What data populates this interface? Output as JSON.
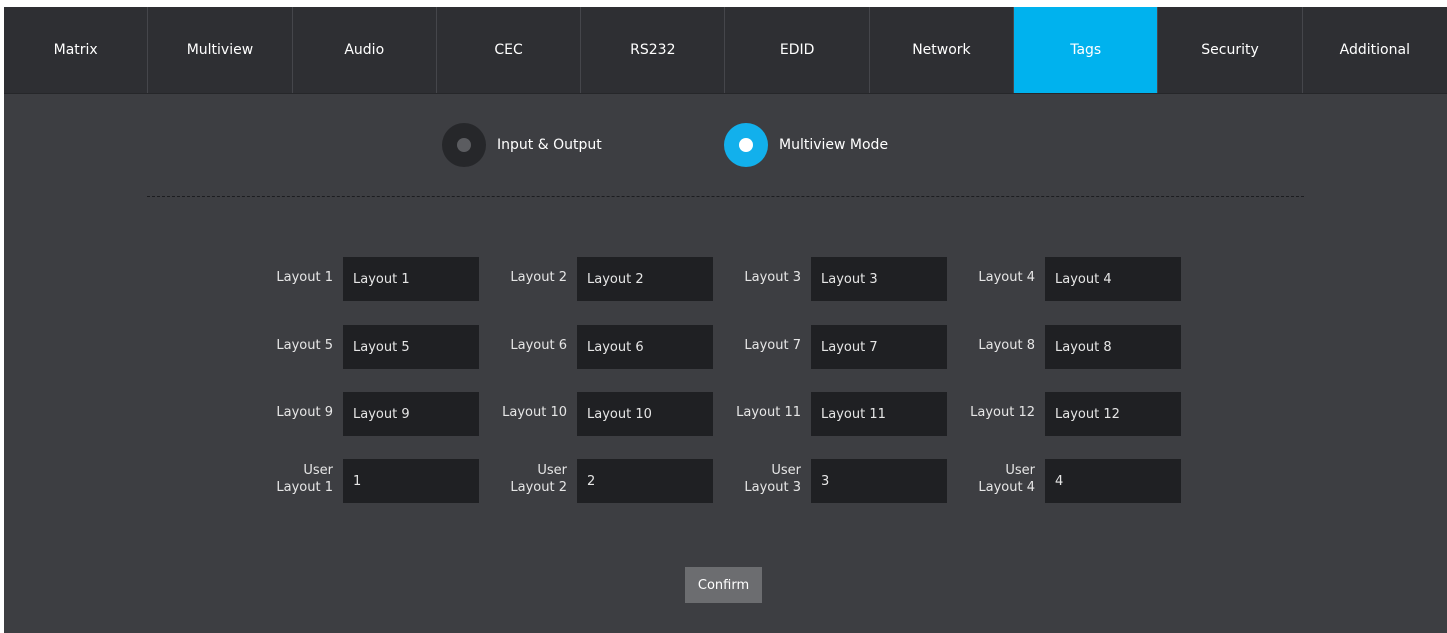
{
  "tabs": [
    {
      "label": "Matrix"
    },
    {
      "label": "Multiview"
    },
    {
      "label": "Audio"
    },
    {
      "label": "CEC"
    },
    {
      "label": "RS232"
    },
    {
      "label": "EDID"
    },
    {
      "label": "Network"
    },
    {
      "label": "Tags"
    },
    {
      "label": "Security"
    },
    {
      "label": "Additional"
    }
  ],
  "active_tab": "Tags",
  "mode": {
    "options": [
      {
        "label": "Input & Output",
        "selected": false
      },
      {
        "label": "Multiview Mode",
        "selected": true
      }
    ]
  },
  "layouts": [
    {
      "label": "Layout 1",
      "value": "Layout 1"
    },
    {
      "label": "Layout 2",
      "value": "Layout 2"
    },
    {
      "label": "Layout 3",
      "value": "Layout 3"
    },
    {
      "label": "Layout 4",
      "value": "Layout 4"
    },
    {
      "label": "Layout 5",
      "value": "Layout 5"
    },
    {
      "label": "Layout 6",
      "value": "Layout 6"
    },
    {
      "label": "Layout 7",
      "value": "Layout 7"
    },
    {
      "label": "Layout 8",
      "value": "Layout 8"
    },
    {
      "label": "Layout 9",
      "value": "Layout 9"
    },
    {
      "label": "Layout 10",
      "value": "Layout 10"
    },
    {
      "label": "Layout 11",
      "value": "Layout 11"
    },
    {
      "label": "Layout 12",
      "value": "Layout 12"
    }
  ],
  "user_layouts": [
    {
      "label_line1": "User",
      "label_line2": "Layout 1",
      "value": "1"
    },
    {
      "label_line1": "User",
      "label_line2": "Layout 2",
      "value": "2"
    },
    {
      "label_line1": "User",
      "label_line2": "Layout 3",
      "value": "3"
    },
    {
      "label_line1": "User",
      "label_line2": "Layout 4",
      "value": "4"
    }
  ],
  "confirm_label": "Confirm",
  "colors": {
    "accent": "#00b2ee",
    "background": "#3d3e42",
    "tab_bar": "#2e2f33",
    "input_bg": "#1f2023",
    "button_bg": "#6c6d70"
  }
}
